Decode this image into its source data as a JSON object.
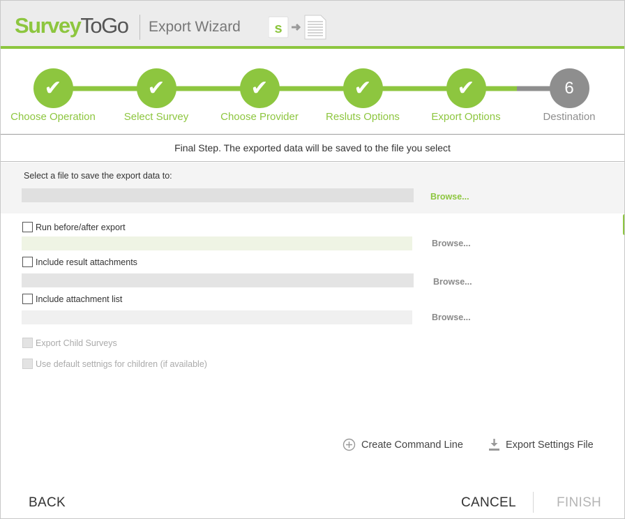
{
  "header": {
    "logo_part1": "Survey",
    "logo_part2": "ToGo",
    "title": "Export Wizard",
    "icon": "survey-to-document-icon"
  },
  "steps": [
    {
      "label": "Choose Operation",
      "status": "done",
      "mark": "✔"
    },
    {
      "label": "Select Survey",
      "status": "done",
      "mark": "✔"
    },
    {
      "label": "Choose Provider",
      "status": "done",
      "mark": "✔"
    },
    {
      "label": "Resluts Options",
      "status": "done",
      "mark": "✔"
    },
    {
      "label": "Export Options",
      "status": "done",
      "mark": "✔"
    },
    {
      "label": "Destination",
      "status": "current",
      "mark": "6"
    }
  ],
  "subtitle": "Final Step. The exported data will be saved to the file you select",
  "file": {
    "label": "Select a file to save the export data to:",
    "value": "",
    "browse_label": "Browse..."
  },
  "options": {
    "run_before_after": {
      "label": "Run before/after export",
      "checked": false,
      "browse_label": "Browse..."
    },
    "include_attachments": {
      "label": "Include result attachments",
      "checked": false,
      "browse_label": "Browse..."
    },
    "include_attachment_list": {
      "label": "Include attachment list",
      "checked": false,
      "browse_label": "Browse..."
    },
    "export_child_surveys": {
      "label": "Export Child Surveys",
      "checked": false,
      "disabled": true
    },
    "use_default_settings": {
      "label": "Use default settnigs for children (if available)",
      "checked": false,
      "disabled": true
    }
  },
  "actions": {
    "create_command_line": "Create Command Line",
    "export_settings_file": "Export Settings File"
  },
  "footer": {
    "back": "BACK",
    "cancel": "CANCEL",
    "finish": "FINISH"
  },
  "colors": {
    "accent": "#8dc63f",
    "pending": "#8e8e8e",
    "disabled_text": "#b5b5b5"
  }
}
